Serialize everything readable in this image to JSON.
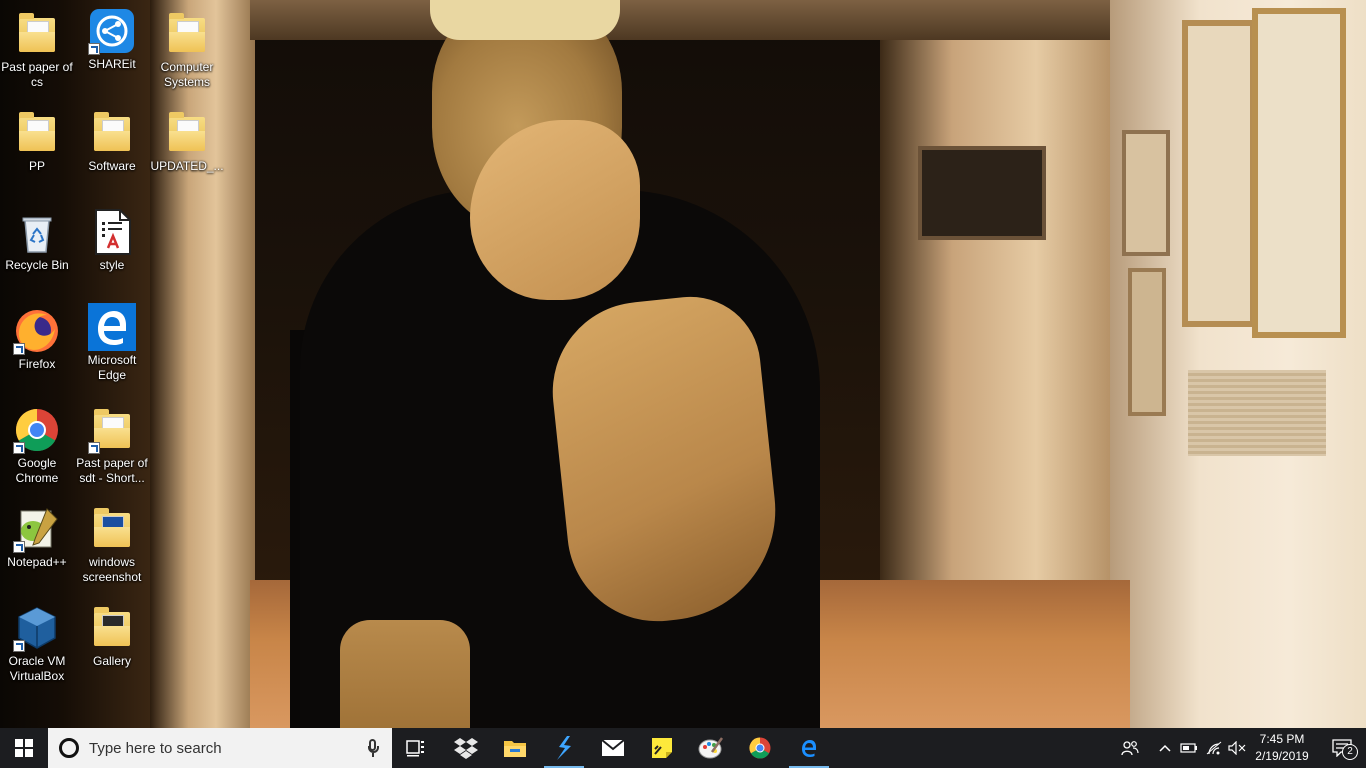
{
  "desktop": {
    "icons": [
      {
        "label": "Past paper of cs",
        "type": "folder"
      },
      {
        "label": "SHAREit",
        "type": "app",
        "icon": "shareit-icon"
      },
      {
        "label": "Computer Systems",
        "type": "folder"
      },
      {
        "label": "PP",
        "type": "folder"
      },
      {
        "label": "Software",
        "type": "folder"
      },
      {
        "label": "UPDATED_...",
        "type": "folder"
      },
      {
        "label": "Recycle Bin",
        "type": "system",
        "icon": "recycle-bin-icon"
      },
      {
        "label": "style",
        "type": "file",
        "icon": "pdf-file-icon"
      },
      {
        "label": "Firefox",
        "type": "app",
        "icon": "firefox-icon"
      },
      {
        "label": "Microsoft Edge",
        "type": "app",
        "icon": "edge-icon"
      },
      {
        "label": "Google Chrome",
        "type": "app",
        "icon": "chrome-icon"
      },
      {
        "label": "Past paper of sdt - Short...",
        "type": "folder-shortcut"
      },
      {
        "label": "Notepad++",
        "type": "app",
        "icon": "notepadpp-icon"
      },
      {
        "label": "windows screenshot",
        "type": "folder"
      },
      {
        "label": "Oracle VM VirtualBox",
        "type": "app",
        "icon": "virtualbox-icon"
      },
      {
        "label": "Gallery",
        "type": "folder"
      }
    ]
  },
  "taskbar": {
    "search_placeholder": "Type here to search",
    "apps": [
      {
        "name": "Task View",
        "icon": "task-view-icon"
      },
      {
        "name": "Dropbox",
        "icon": "dropbox-icon"
      },
      {
        "name": "File Explorer",
        "icon": "folder-icon"
      },
      {
        "name": "Visual Studio",
        "icon": "visual-studio-icon"
      },
      {
        "name": "Mail",
        "icon": "mail-icon"
      },
      {
        "name": "Sticky Notes",
        "icon": "sticky-notes-icon"
      },
      {
        "name": "Paint",
        "icon": "paint-icon"
      },
      {
        "name": "Google Chrome",
        "icon": "chrome-icon"
      },
      {
        "name": "Microsoft Edge",
        "icon": "edge-icon"
      }
    ],
    "tray": {
      "time": "7:45 PM",
      "date": "2/19/2019",
      "notifications_count": "2"
    }
  },
  "colors": {
    "taskbar_bg": "#1c1d20",
    "active_indicator": "#76b9ed",
    "edge_blue": "#0a74d8"
  }
}
